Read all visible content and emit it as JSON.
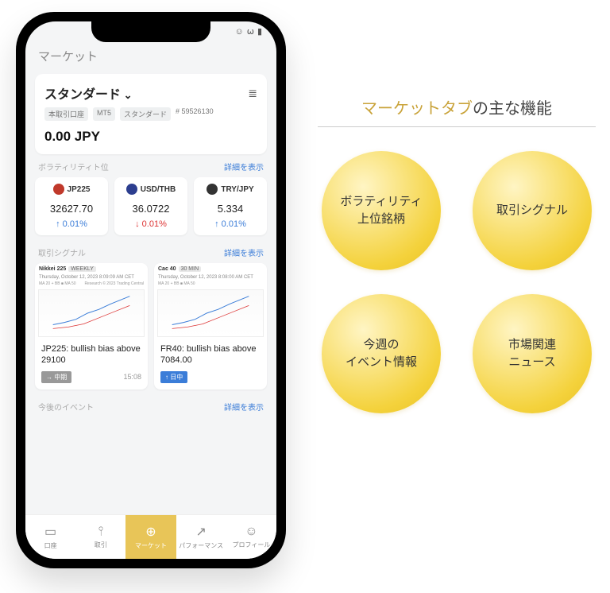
{
  "header": {
    "title": "マーケット"
  },
  "account": {
    "name": "スタンダード",
    "tags": [
      "本取引口座",
      "MT5",
      "スタンダード",
      "# 59526130"
    ],
    "balance": "0.00 JPY"
  },
  "volatility": {
    "label": "ボラティリティト位",
    "link": "詳細を表示",
    "items": [
      {
        "flag_color": "#c0392b",
        "symbol": "JP225",
        "price": "32627.70",
        "change": "0.01%",
        "dir": "up"
      },
      {
        "flag_color": "#2c3e8f",
        "symbol": "USD/THB",
        "price": "36.0722",
        "change": "0.01%",
        "dir": "down"
      },
      {
        "flag_color": "#333",
        "symbol": "TRY/JPY",
        "price": "5.334",
        "change": "0.01%",
        "dir": "up"
      }
    ]
  },
  "signals": {
    "label": "取引シグナル",
    "link": "詳細を表示",
    "items": [
      {
        "name": "Nikkei 225",
        "tf": "WEEKLY",
        "date": "Thursday, October 12, 2023 8:09:09 AM CET",
        "meta_left": "MA 20 + BB ■ MA 50",
        "meta_right": "Research © 2023 Trading Central",
        "title": "JP225: bullish bias above 29100",
        "badge": "→ 中期",
        "badge_class": "bg-gray",
        "time": "15:08"
      },
      {
        "name": "Cac 40",
        "tf": "30 MIN",
        "date": "Thursday, October 12, 2023 8:08:00 AM CET",
        "meta_left": "MA 20 + BB ■ MA 50",
        "meta_right": "",
        "title": "FR40: bullish bias above 7084.00",
        "badge": "↑ 日中",
        "badge_class": "bg-blue",
        "time": ""
      }
    ]
  },
  "events": {
    "label": "今後のイベント",
    "link": "詳細を表示"
  },
  "nav": [
    {
      "icon": "▭",
      "label": "口座"
    },
    {
      "icon": "⫯",
      "label": "取引"
    },
    {
      "icon": "⊕",
      "label": "マーケット",
      "active": true
    },
    {
      "icon": "↗",
      "label": "パフォーマンス"
    },
    {
      "icon": "☺",
      "label": "プロフィール"
    }
  ],
  "info": {
    "title_gold": "マーケットタブ",
    "title_rest": "の主な機能",
    "circles": [
      "ボラティリティ\n上位銘柄",
      "取引シグナル",
      "今週の\nイベント情報",
      "市場関連\nニュース"
    ]
  }
}
